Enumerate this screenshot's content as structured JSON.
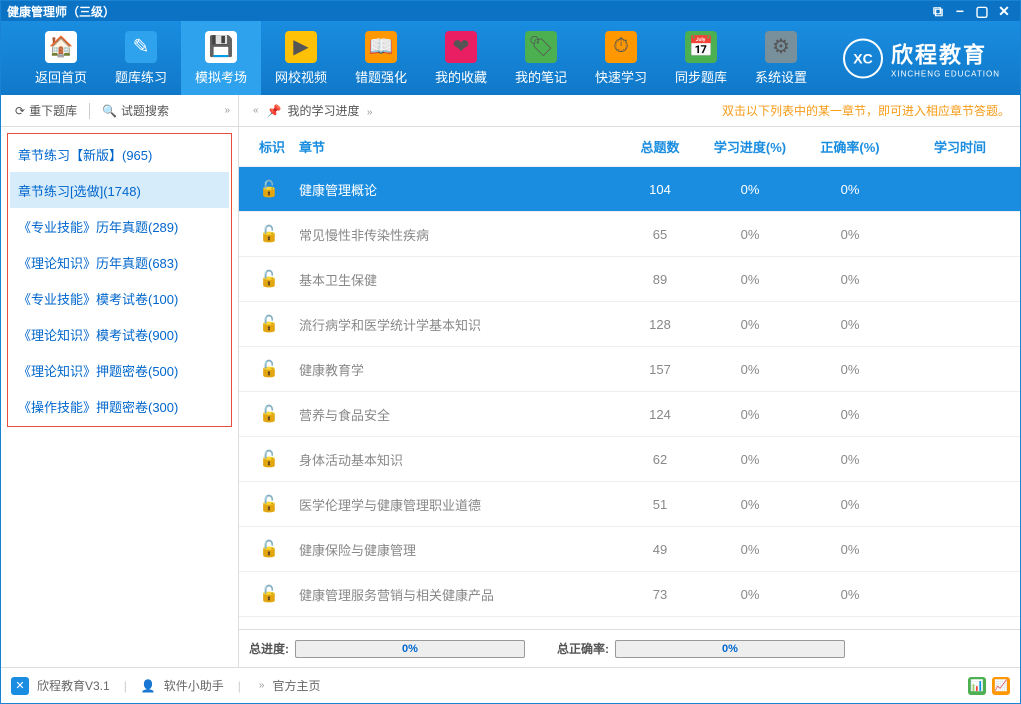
{
  "window": {
    "title": "健康管理师（三级）"
  },
  "toolbar": [
    {
      "label": "返回首页",
      "icon": "🏠",
      "bg": "#fff"
    },
    {
      "label": "题库练习",
      "icon": "✎",
      "bg": "#2ea2ec"
    },
    {
      "label": "模拟考场",
      "icon": "💾",
      "bg": "#fff"
    },
    {
      "label": "网校视频",
      "icon": "▶",
      "bg": "#ffc107"
    },
    {
      "label": "错题强化",
      "icon": "📖",
      "bg": "#ff9800"
    },
    {
      "label": "我的收藏",
      "icon": "❤",
      "bg": "#e91e63"
    },
    {
      "label": "我的笔记",
      "icon": "🏷",
      "bg": "#4caf50"
    },
    {
      "label": "快速学习",
      "icon": "⏱",
      "bg": "#ff9800"
    },
    {
      "label": "同步题库",
      "icon": "📅",
      "bg": "#4caf50"
    },
    {
      "label": "系统设置",
      "icon": "⚙",
      "bg": "#78909c"
    }
  ],
  "brand": {
    "name": "欣程教育",
    "sub": "XINCHENG EDUCATION",
    "logo": "XC"
  },
  "sidebar": {
    "reload": "重下题库",
    "search": "试题搜索",
    "items": [
      {
        "label": "章节练习【新版】(965)"
      },
      {
        "label": "章节练习[选做](1748)"
      },
      {
        "label": "《专业技能》历年真题(289)"
      },
      {
        "label": "《理论知识》历年真题(683)"
      },
      {
        "label": "《专业技能》模考试卷(100)"
      },
      {
        "label": "《理论知识》模考试卷(900)"
      },
      {
        "label": "《理论知识》押题密卷(500)"
      },
      {
        "label": "《操作技能》押题密卷(300)"
      }
    ]
  },
  "main": {
    "progress_link": "我的学习进度",
    "hint": "双击以下列表中的某一章节，即可进入相应章节答题。",
    "columns": {
      "icon": "标识",
      "chapter": "章节",
      "total": "总题数",
      "progress": "学习进度(%)",
      "accuracy": "正确率(%)",
      "time": "学习时间"
    },
    "rows": [
      {
        "chapter": "健康管理概论",
        "total": "104",
        "progress": "0%",
        "accuracy": "0%"
      },
      {
        "chapter": "常见慢性非传染性疾病",
        "total": "65",
        "progress": "0%",
        "accuracy": "0%"
      },
      {
        "chapter": "基本卫生保健",
        "total": "89",
        "progress": "0%",
        "accuracy": "0%"
      },
      {
        "chapter": "流行病学和医学统计学基本知识",
        "total": "128",
        "progress": "0%",
        "accuracy": "0%"
      },
      {
        "chapter": "健康教育学",
        "total": "157",
        "progress": "0%",
        "accuracy": "0%"
      },
      {
        "chapter": "营养与食品安全",
        "total": "124",
        "progress": "0%",
        "accuracy": "0%"
      },
      {
        "chapter": "身体活动基本知识",
        "total": "62",
        "progress": "0%",
        "accuracy": "0%"
      },
      {
        "chapter": "医学伦理学与健康管理职业道德",
        "total": "51",
        "progress": "0%",
        "accuracy": "0%"
      },
      {
        "chapter": "健康保险与健康管理",
        "total": "49",
        "progress": "0%",
        "accuracy": "0%"
      },
      {
        "chapter": "健康管理服务营销与相关健康产品",
        "total": "73",
        "progress": "0%",
        "accuracy": "0%"
      }
    ],
    "summary": {
      "total_label": "总进度:",
      "total_val": "0%",
      "acc_label": "总正确率:",
      "acc_val": "0%"
    }
  },
  "statusbar": {
    "app": "欣程教育V3.1",
    "helper": "软件小助手",
    "home": "官方主页"
  }
}
